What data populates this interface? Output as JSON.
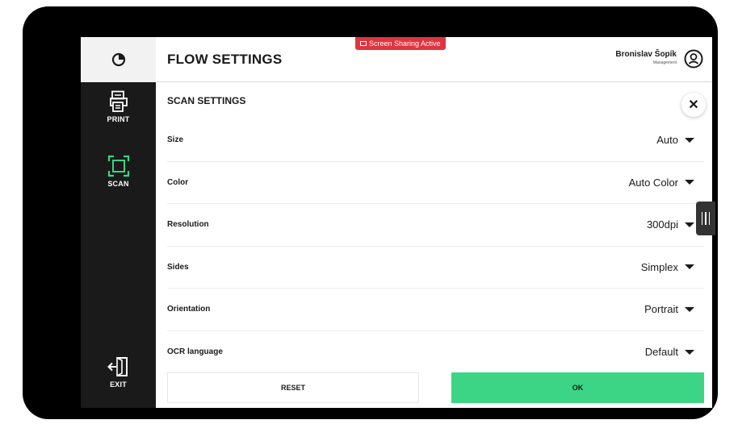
{
  "header": {
    "title": "FLOW SETTINGS",
    "share_badge": "Screen Sharing Active",
    "user_name": "Bronislav Šopík",
    "user_role": "Management"
  },
  "sidebar": {
    "items": [
      {
        "label": "PRINT",
        "icon": "printer-icon",
        "active": false
      },
      {
        "label": "SCAN",
        "icon": "scan-icon",
        "active": true
      },
      {
        "label": "EXIT",
        "icon": "exit-icon",
        "active": false
      }
    ]
  },
  "section": {
    "title": "SCAN SETTINGS"
  },
  "settings": [
    {
      "label": "Size",
      "value": "Auto"
    },
    {
      "label": "Color",
      "value": "Auto Color"
    },
    {
      "label": "Resolution",
      "value": "300dpi"
    },
    {
      "label": "Sides",
      "value": "Simplex"
    },
    {
      "label": "Orientation",
      "value": "Portrait"
    },
    {
      "label": "OCR language",
      "value": "Default"
    }
  ],
  "footer": {
    "reset_label": "RESET",
    "ok_label": "OK"
  },
  "colors": {
    "accent": "#3bd585",
    "alert": "#e0343f",
    "sidebar": "#1a1a1a"
  }
}
